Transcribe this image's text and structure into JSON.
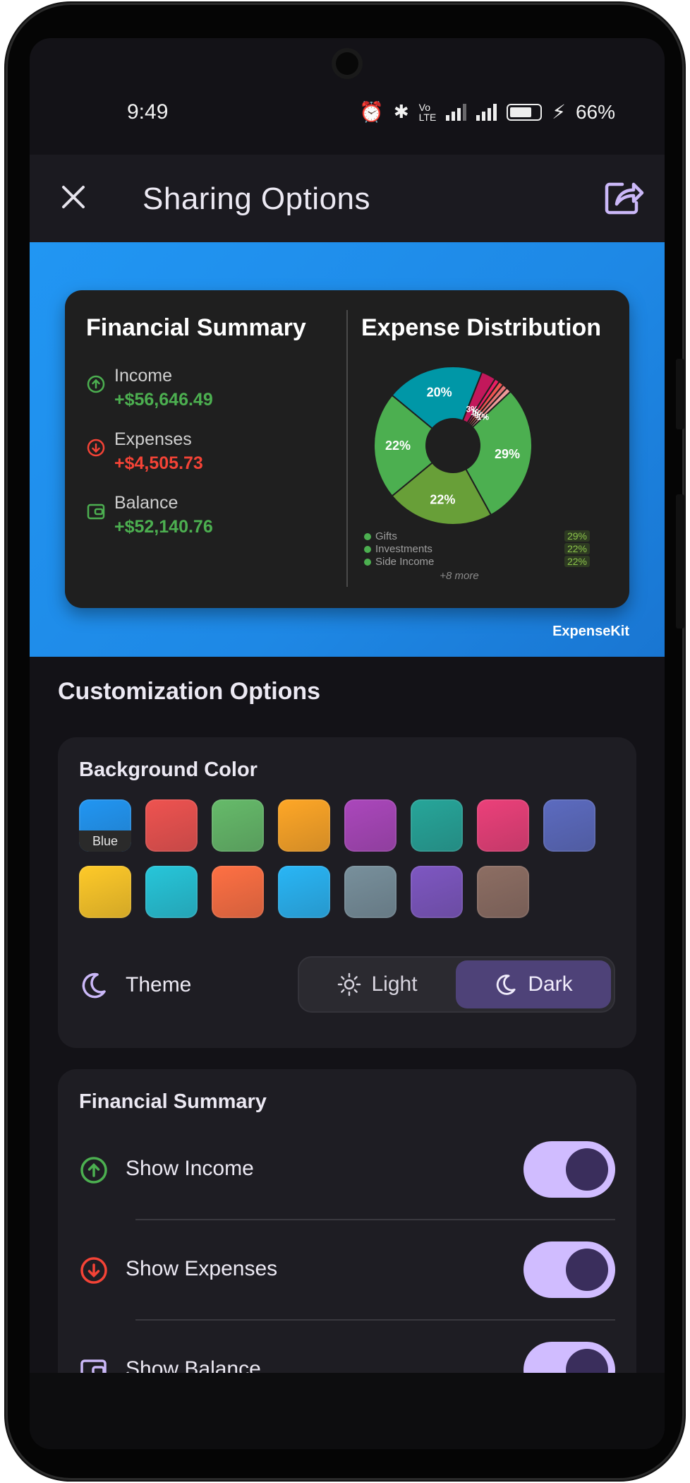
{
  "status_bar": {
    "time": "9:49",
    "battery": "66%"
  },
  "header": {
    "title": "Sharing Options"
  },
  "preview": {
    "financial_summary": {
      "title": "Financial Summary",
      "income_label": "Income",
      "income_value": "+$56,646.49",
      "expenses_label": "Expenses",
      "expenses_value": "+$4,505.73",
      "balance_label": "Balance",
      "balance_value": "+$52,140.76"
    },
    "expense_distribution": {
      "title": "Expense Distribution",
      "legend": [
        {
          "name": "Gifts",
          "percent": "29%"
        },
        {
          "name": "Investments",
          "percent": "22%"
        },
        {
          "name": "Side Income",
          "percent": "22%"
        }
      ],
      "more": "+8 more"
    },
    "brand": "ExpenseKit"
  },
  "chart_data": {
    "type": "pie",
    "title": "Expense Distribution",
    "slices": [
      {
        "label": "",
        "value": 29,
        "color": "#4caf50",
        "text": "29%"
      },
      {
        "label": "",
        "value": 22,
        "color": "#689f38",
        "text": "22%"
      },
      {
        "label": "",
        "value": 22,
        "color": "#4caf50",
        "text": "22%"
      },
      {
        "label": "",
        "value": 20,
        "color": "#0097a7",
        "text": "20%"
      },
      {
        "label": "",
        "value": 3,
        "color": "#c2185b",
        "text": "3%"
      },
      {
        "label": "",
        "value": 1,
        "color": "#e91e63",
        "text": "1%"
      },
      {
        "label": "",
        "value": 1,
        "color": "#ef5350",
        "text": "1%"
      },
      {
        "label": "",
        "value": 1,
        "color": "#e57373",
        "text": "1%"
      },
      {
        "label": "",
        "value": 1,
        "color": "#ef9a9a",
        "text": "1%"
      }
    ]
  },
  "customization": {
    "title": "Customization Options",
    "background_color": {
      "title": "Background Color",
      "selected_label": "Blue",
      "swatches": [
        "#2196f3",
        "#ef5350",
        "#66bb6a",
        "#ffa726",
        "#ab47bc",
        "#26a69a",
        "#ec407a",
        "#5c6bc0",
        "#ffca28",
        "#26c6da",
        "#ff7043",
        "#29b6f6",
        "#78909c",
        "#7e57c2",
        "#8d6e63"
      ]
    },
    "theme": {
      "label": "Theme",
      "light": "Light",
      "dark": "Dark",
      "selected": "Dark"
    }
  },
  "financial_options": {
    "title": "Financial Summary",
    "show_income": "Show Income",
    "show_expenses": "Show Expenses",
    "show_balance": "Show Balance"
  },
  "colors": {
    "income": "#4caf50",
    "expense": "#f44336",
    "accent": "#d0bcff"
  }
}
